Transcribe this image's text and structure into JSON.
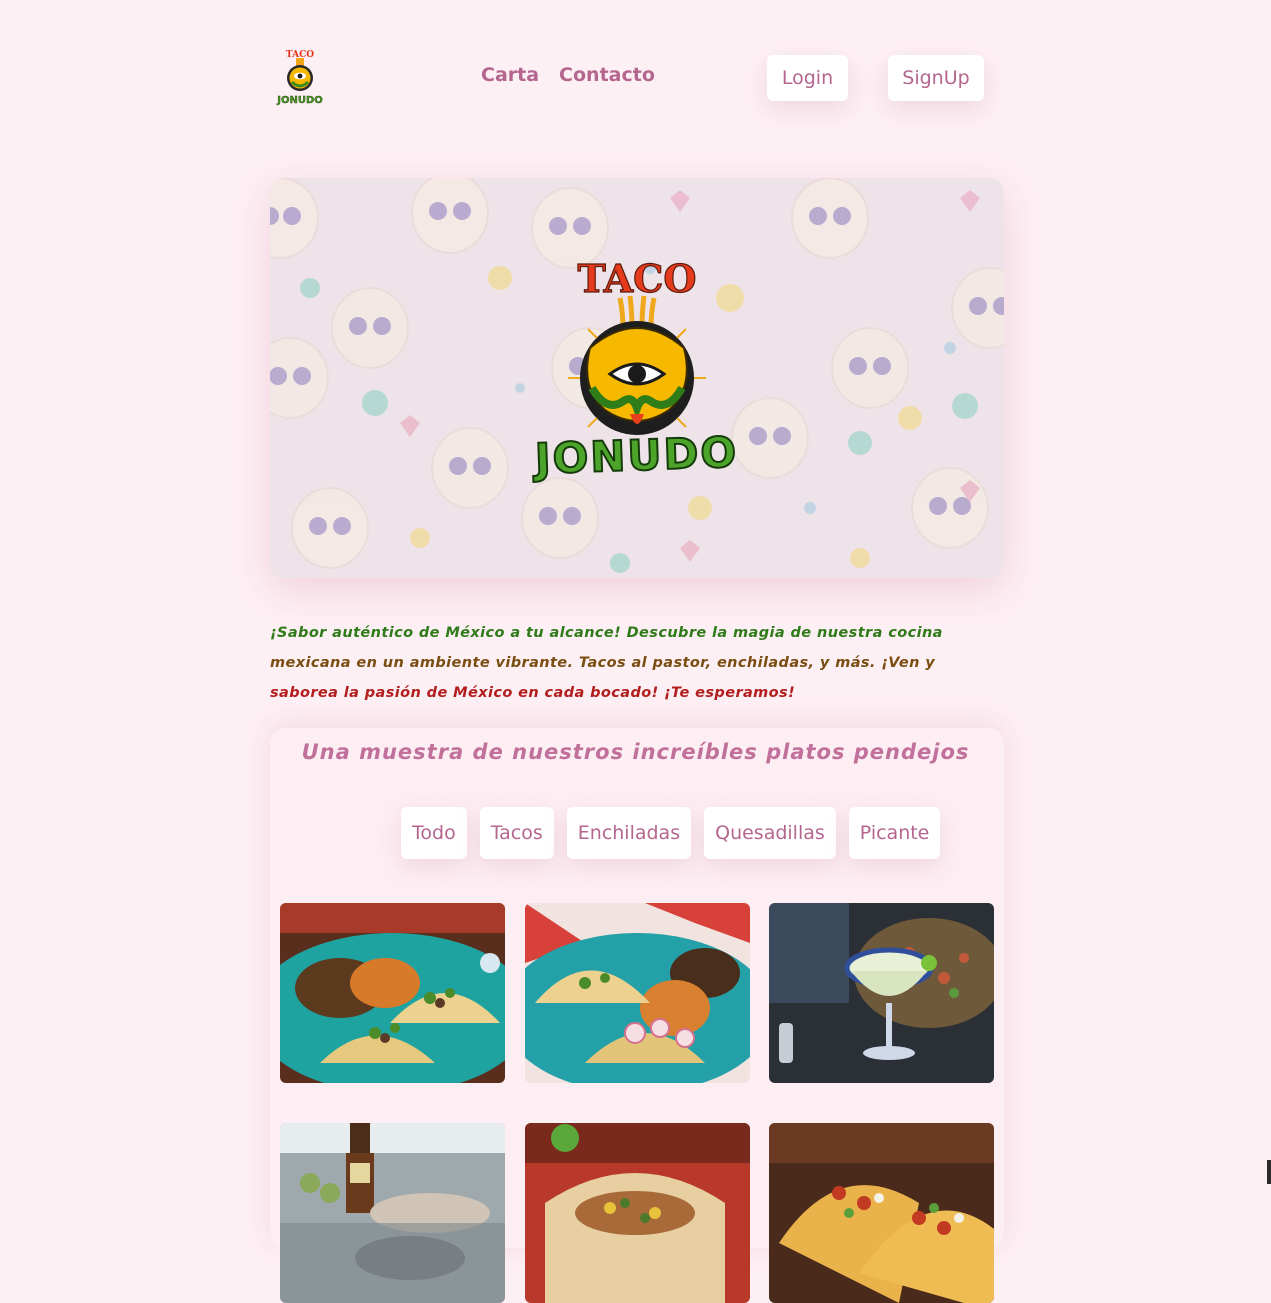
{
  "header": {
    "logo": {
      "top_text": "TACO",
      "bottom_text": "JONUDO",
      "icon": "taco-jonudo-logo-icon"
    },
    "nav": [
      {
        "label": "Carta"
      },
      {
        "label": "Contacto"
      }
    ],
    "login_label": "Login",
    "signup_label": "SignUp"
  },
  "hero": {
    "logo_top_text": "TACO",
    "logo_bottom_text": "JONUDO",
    "background": "sugar-skull-pattern"
  },
  "intro": {
    "sentence_1": "¡Sabor auténtico de México a tu alcance! Descubre la magia de nuestra cocina",
    "sentence_2": "mexicana en un ambiente vibrante. Tacos al pastor, enchiladas, y más. ¡Ven y",
    "sentence_3": "saborea la pasión de México en cada bocado! ¡Te esperamos!"
  },
  "gallery": {
    "title": "Una muestra de nuestros increíbles platos pendejos",
    "filters": [
      {
        "label": "Todo"
      },
      {
        "label": "Tacos"
      },
      {
        "label": "Enchiladas"
      },
      {
        "label": "Quesadillas"
      },
      {
        "label": "Picante"
      }
    ],
    "photos": [
      {
        "name": "tacos-plate-photo"
      },
      {
        "name": "tacos-radish-photo"
      },
      {
        "name": "margarita-nachos-photo"
      },
      {
        "name": "beer-salsa-photo"
      },
      {
        "name": "burrito-photo"
      },
      {
        "name": "crispy-tacos-photo"
      }
    ]
  },
  "colors": {
    "background": "#fdf0f4",
    "accent": "#b4668f",
    "green": "#2f7a19",
    "brown": "#7a4e12",
    "red": "#b31e1e"
  }
}
